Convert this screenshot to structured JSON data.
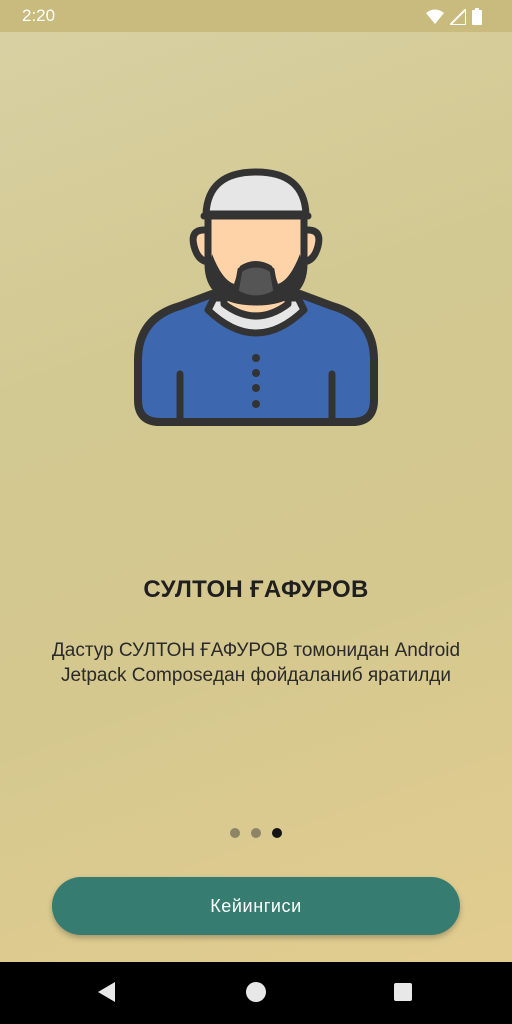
{
  "status_bar": {
    "time": "2:20",
    "icons": [
      "wifi-icon",
      "signal-icon",
      "battery-icon"
    ]
  },
  "onboarding": {
    "illustration": "man-avatar-illustration",
    "title": "СУЛТОН ҒАФУРОВ",
    "description": "Дастур СУЛТОН ҒАФУРОВ томонидан Android Jetpack Composeдан фойдаланиб яратилди",
    "pager": {
      "total": 3,
      "current": 3
    },
    "next_button_label": "Кейингиси"
  },
  "navigation_bar": {
    "buttons": [
      "back-icon",
      "home-icon",
      "recents-icon"
    ]
  },
  "colors": {
    "button": "#367c71",
    "shirt": "#3d68b0",
    "skin": "#ffd3a8",
    "outline": "#333333",
    "cap": "#e6e6e6"
  }
}
